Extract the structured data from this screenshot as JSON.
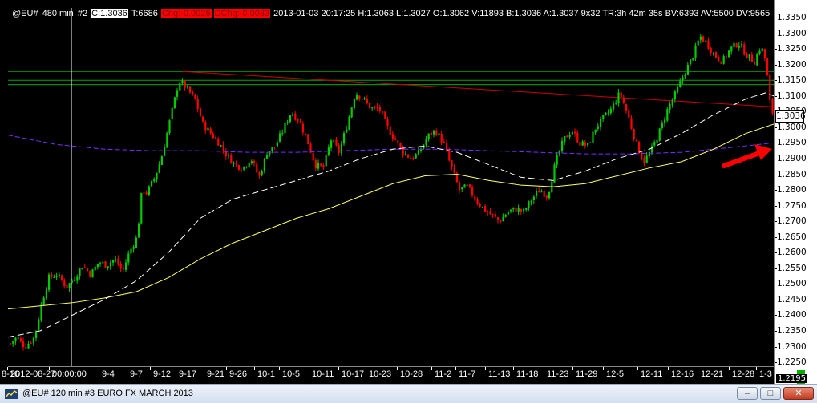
{
  "info_bar": {
    "symbol": "@EU#",
    "interval": "480 min",
    "window_no": "#2",
    "close": "C:1.3036",
    "ticks": "T:6686",
    "chg": "Chg:-0.0026",
    "dchg": "DChg:-0.0033",
    "rest": "2013-01-03 20:17:25 H:1.3063 L:1.3027 O:1.3062 V:11893 B:1.3036 A:1.3037 9x32 TR:3h 42m 35s BV:6393 AV:5500 DV:9565"
  },
  "price_axis": {
    "ticks": [
      "1.3350",
      "1.3300",
      "1.3250",
      "1.3200",
      "1.3150",
      "1.3100",
      "1.3050",
      "1.3000",
      "1.2950",
      "1.2900",
      "1.2850",
      "1.2800",
      "1.2750",
      "1.2700",
      "1.2650",
      "1.2600",
      "1.2550",
      "1.2500",
      "1.2450",
      "1.2400",
      "1.2350",
      "1.2300",
      "1.2250"
    ],
    "last_price": "1.3036",
    "bottom_label": "1.2195"
  },
  "time_axis": {
    "labels": [
      "8-16",
      "2012-08-27",
      "00:00:00",
      "9-4",
      "9-7",
      "9-12",
      "9-17",
      "9-21",
      "9-26",
      "10-1",
      "10-5",
      "10-11",
      "10-17",
      "10-23",
      "10-28",
      "11-2",
      "11-7",
      "11-13",
      "11-18",
      "11-23",
      "11-29",
      "12-5",
      "12-11",
      "12-16",
      "12-21",
      "12-28",
      "1-3"
    ]
  },
  "status_bar": {
    "text": "@EU#  120 min   #3  EURO FX MARCH 2013",
    "minimize_label": "–",
    "maximize_label": "□",
    "close_label": "✕"
  },
  "colors": {
    "background": "#000000",
    "bull_candle": "#00cc00",
    "bear_candle": "#ff0000",
    "ma_fast": "#ffffff",
    "ma_slow": "#ffff66",
    "ma_long": "#7a2cff",
    "resistance": "#00aa00",
    "trendline": "#cc0000",
    "arrow": "#ff0000",
    "cursor_line": "#ffffff"
  }
}
